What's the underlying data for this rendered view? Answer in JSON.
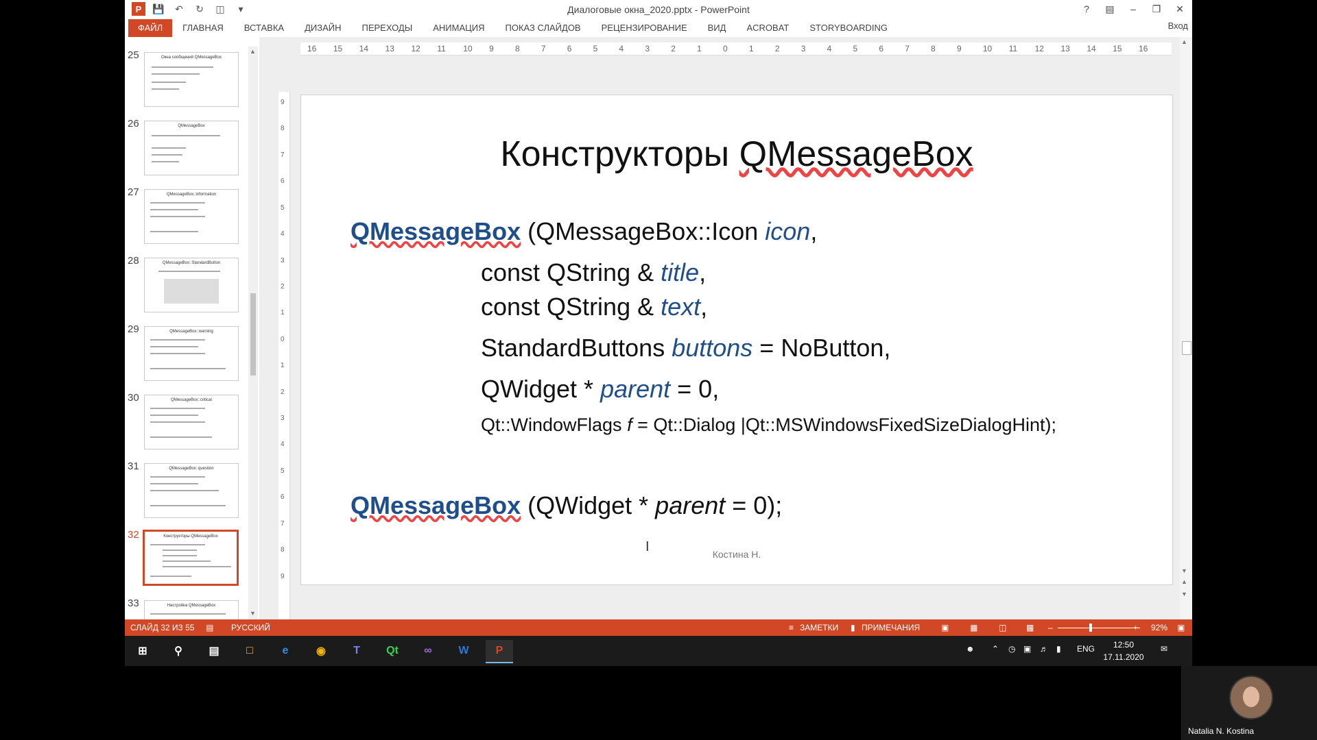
{
  "window": {
    "title": "Диалоговые окна_2020.pptx - PowerPoint",
    "help": "?",
    "signin": "Вход"
  },
  "ribbon_tabs": [
    "ФАЙЛ",
    "ГЛАВНАЯ",
    "ВСТАВКА",
    "ДИЗАЙН",
    "ПЕРЕХОДЫ",
    "АНИМАЦИЯ",
    "ПОКАЗ СЛАЙДОВ",
    "РЕЦЕНЗИРОВАНИЕ",
    "ВИД",
    "ACROBAT",
    "STORYBOARDING"
  ],
  "thumbnails": [
    {
      "num": "25",
      "title": "Окна сообщений QMessageBox"
    },
    {
      "num": "26",
      "title": "QMessageBox"
    },
    {
      "num": "27",
      "title": "QMessageBox::information"
    },
    {
      "num": "28",
      "title": "QMessageBox::StandardButton"
    },
    {
      "num": "29",
      "title": "QMessageBox::warning"
    },
    {
      "num": "30",
      "title": "QMessageBox::critical"
    },
    {
      "num": "31",
      "title": "QMessageBox::question"
    },
    {
      "num": "32",
      "title": "Конструкторы QMessageBox"
    },
    {
      "num": "33",
      "title": "Настройка QMessageBox"
    }
  ],
  "selected_slide": "32",
  "ruler": {
    "h": [
      "16",
      "15",
      "14",
      "13",
      "12",
      "11",
      "10",
      "9",
      "8",
      "7",
      "6",
      "5",
      "4",
      "3",
      "2",
      "1",
      "0",
      "1",
      "2",
      "3",
      "4",
      "5",
      "6",
      "7",
      "8",
      "9",
      "10",
      "11",
      "12",
      "13",
      "14",
      "15",
      "16"
    ],
    "v": [
      "9",
      "8",
      "7",
      "6",
      "5",
      "4",
      "3",
      "2",
      "1",
      "0",
      "1",
      "2",
      "3",
      "4",
      "5",
      "6",
      "7",
      "8",
      "9"
    ]
  },
  "slide": {
    "title_plain": "Конструкторы ",
    "title_class": "QMessageBox",
    "l1_kw": "QMessageBox",
    "l1_a": " (QMessageBox::Icon ",
    "l1_it": "icon",
    "l1_b": ",",
    "l2_a": "const QString & ",
    "l2_it": "title",
    "l2_b": ",",
    "l3_a": "const QString & ",
    "l3_it": "text",
    "l3_b": ",",
    "l4_a": "StandardButtons ",
    "l4_it": "buttons",
    "l4_b": " = NoButton,",
    "l5_a": "QWidget * ",
    "l5_it": "parent",
    "l5_b": " = 0,",
    "l6_a": "Qt::WindowFlags ",
    "l6_it": "f",
    "l6_b": " = Qt::Dialog |Qt::MSWindowsFixedSizeDialogHint);",
    "l7_kw": "QMessageBox",
    "l7_a": " (QWidget * ",
    "l7_it": "parent",
    "l7_b": " = 0);",
    "footer": "Костина  Н."
  },
  "status": {
    "slide_counter": "СЛАЙД 32 ИЗ 55",
    "language": "РУССКИЙ",
    "notes": "ЗАМЕТКИ",
    "comments": "ПРИМЕЧАНИЯ",
    "zoom": "92%"
  },
  "taskbar": {
    "lang": "ENG",
    "time": "12:50",
    "date": "17.11.2020"
  },
  "webcam": {
    "name": "Natalia N. Kostina"
  },
  "colors": {
    "accent": "#d24726",
    "keyword": "#1f4e8c"
  }
}
